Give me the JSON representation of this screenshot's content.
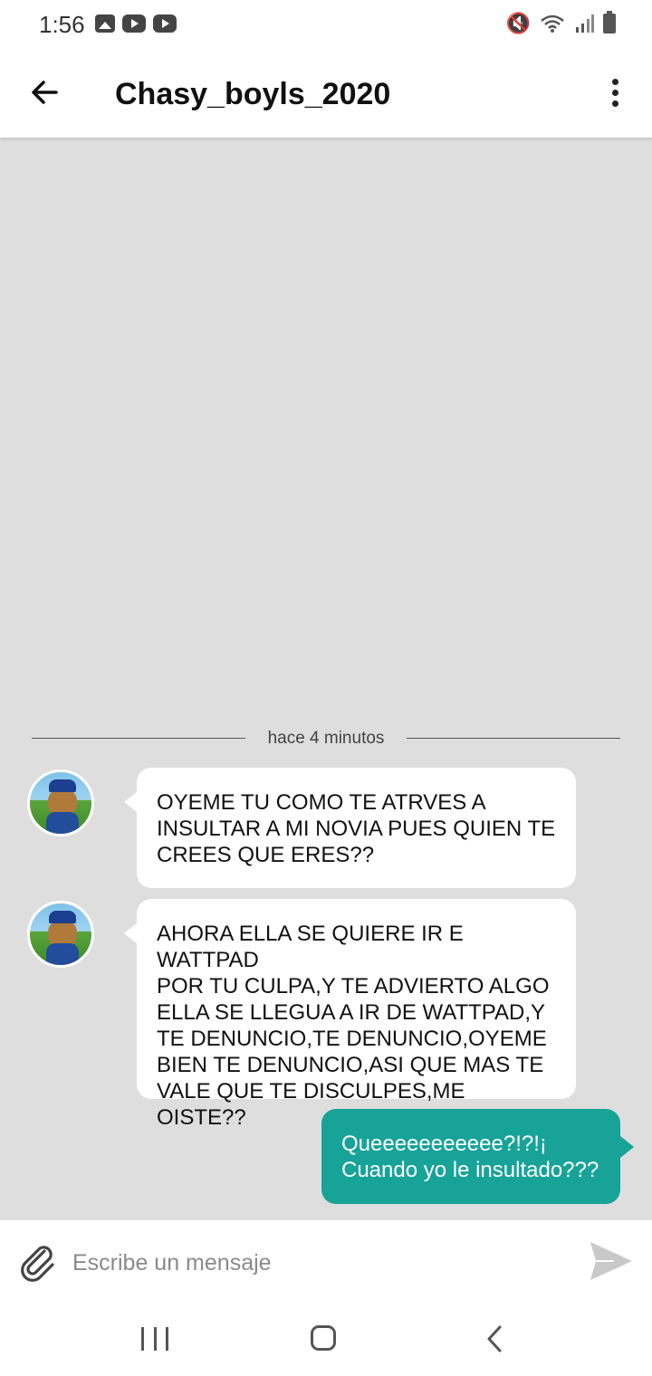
{
  "status_bar": {
    "time": "1:56",
    "left_icons": [
      "gallery-icon",
      "youtube-icon",
      "youtube-icon"
    ],
    "right_icons": [
      "mute-icon",
      "wifi-icon",
      "signal-icon",
      "battery-icon"
    ]
  },
  "header": {
    "title": "Chasy_boyls_2020",
    "back_icon": "arrow-left-icon",
    "menu_icon": "more-vertical-icon"
  },
  "conversation": {
    "time_divider": "hace 4 minutos",
    "messages": [
      {
        "direction": "incoming",
        "text": "OYEME TU COMO TE ATRVES A\nINSULTAR A MI NOVIA PUES QUIEN TE\nCREES QUE ERES??"
      },
      {
        "direction": "incoming",
        "text": "AHORA ELLA SE QUIERE IR E WATTPAD\nPOR TU CULPA,Y TE ADVIERTO ALGO\nELLA SE LLEGUA A IR DE WATTPAD,Y\nTE DENUNCIO,TE DENUNCIO,OYEME\nBIEN TE DENUNCIO,ASI QUE MAS TE\nVALE QUE TE DISCULPES,ME OISTE??"
      },
      {
        "direction": "outgoing",
        "text": "Queeeeeeeeeee?!?!¡\nCuando yo le insultado???"
      }
    ]
  },
  "composer": {
    "placeholder": "Escribe un mensaje",
    "value": "",
    "attach_icon": "paperclip-icon",
    "send_icon": "send-icon"
  },
  "colors": {
    "outgoing_bubble": "#17a398",
    "chat_background": "#dedede"
  }
}
